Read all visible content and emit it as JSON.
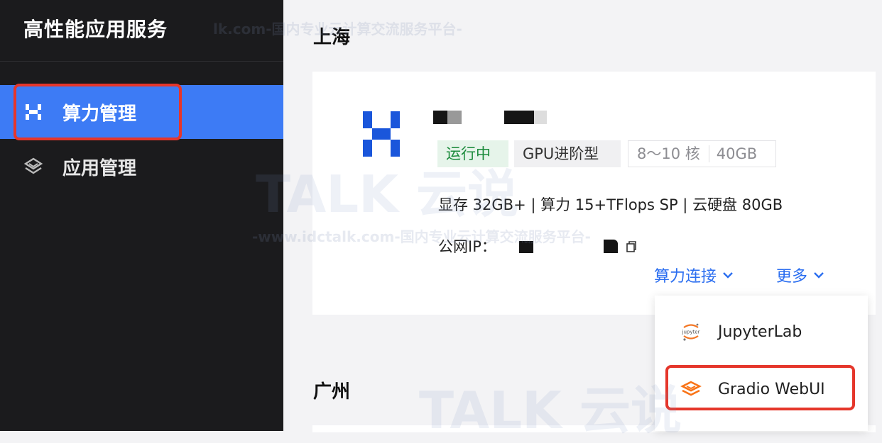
{
  "sidebar": {
    "brand": "高性能应用服务",
    "items": [
      {
        "label": "算力管理",
        "icon": "compute-logo-icon",
        "active": true
      },
      {
        "label": "应用管理",
        "icon": "layers-icon",
        "active": false
      }
    ]
  },
  "regions": [
    {
      "title": "上海"
    },
    {
      "title": "广州"
    }
  ],
  "instance": {
    "tags": {
      "status": "运行中",
      "type": "GPU进阶型",
      "cores": "8～10 核",
      "memory": "40GB"
    },
    "spec_line": "显存 32GB+ | 算力 15+TFlops SP | 云硬盘 80GB",
    "ip_label": "公网IP：",
    "actions": {
      "connect": "算力连接",
      "more": "更多"
    }
  },
  "dropdown": {
    "items": [
      {
        "label": "JupyterLab",
        "icon": "jupyter-icon"
      },
      {
        "label": "Gradio WebUI",
        "icon": "gradio-icon"
      }
    ]
  },
  "watermark": {
    "brand": "TALK 云说",
    "url_text": "-www.idctalk.com-国内专业云计算交流服务平台-",
    "partial_url": "lk.com-国内专业云计算交流服务平台-"
  },
  "colors": {
    "sidebar_bg": "#1b1b1d",
    "active_nav": "#3d7bf5",
    "highlight": "#e5362b",
    "link": "#2b6ef0",
    "running_tag": "#1a8a3a"
  }
}
